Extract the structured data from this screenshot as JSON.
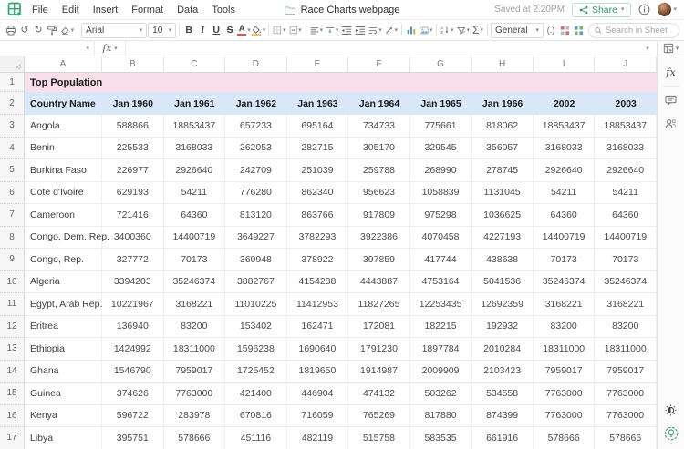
{
  "app": {
    "menus": [
      "File",
      "Edit",
      "Insert",
      "Format",
      "Data",
      "Tools"
    ],
    "doc_title": "Race Charts webpage",
    "saved_status": "Saved at 2.20PM",
    "share_label": "Share"
  },
  "toolbar": {
    "font_name": "Arial",
    "font_size": "10",
    "number_format": "General",
    "search_placeholder": "Search in Sheet",
    "format_buttons": {
      "bold": "B",
      "italic": "I",
      "underline": "U",
      "strikethrough": "S"
    },
    "glyphs": {
      "undo": "↺",
      "redo": "↻",
      "sum": "Σ",
      "decimal": "(.)",
      "font_color_letter": "A"
    }
  },
  "formula_bar": {
    "name_box_value": "",
    "fx_label": "fx",
    "formula_value": ""
  },
  "colors": {
    "title_row_bg": "#f8dfe9",
    "header_row_bg": "#d9e8f8",
    "accent_green": "#28a96c"
  },
  "grid": {
    "column_letters": [
      "A",
      "B",
      "C",
      "D",
      "E",
      "F",
      "G",
      "H",
      "I",
      "J"
    ],
    "title_row": {
      "n": "1",
      "text": "Top Population"
    },
    "header_row": {
      "n": "2",
      "cells": [
        "Country Name",
        "Jan 1960",
        "Jan 1961",
        "Jan 1962",
        "Jan 1963",
        "Jan 1964",
        "Jan 1965",
        "Jan 1966",
        "2002",
        "2003"
      ]
    },
    "rows": [
      {
        "n": "3",
        "country": "Angola",
        "values": [
          "588866",
          "18853437",
          "657233",
          "695164",
          "734733",
          "775661",
          "818062",
          "18853437",
          "18853437"
        ]
      },
      {
        "n": "4",
        "country": "Benin",
        "values": [
          "225533",
          "3168033",
          "262053",
          "282715",
          "305170",
          "329545",
          "356057",
          "3168033",
          "3168033"
        ]
      },
      {
        "n": "5",
        "country": "Burkina Faso",
        "values": [
          "226977",
          "2926640",
          "242709",
          "251039",
          "259788",
          "268990",
          "278745",
          "2926640",
          "2926640"
        ]
      },
      {
        "n": "6",
        "country": "Cote d'Ivoire",
        "values": [
          "629193",
          "54211",
          "776280",
          "862340",
          "956623",
          "1058839",
          "1131045",
          "54211",
          "54211"
        ]
      },
      {
        "n": "7",
        "country": "Cameroon",
        "values": [
          "721416",
          "64360",
          "813120",
          "863766",
          "917809",
          "975298",
          "1036625",
          "64360",
          "64360"
        ]
      },
      {
        "n": "8",
        "country": "Congo, Dem. Rep.",
        "values": [
          "3400360",
          "14400719",
          "3649227",
          "3782293",
          "3922386",
          "4070458",
          "4227193",
          "14400719",
          "14400719"
        ]
      },
      {
        "n": "9",
        "country": "Congo, Rep.",
        "values": [
          "327772",
          "70173",
          "360948",
          "378922",
          "397859",
          "417744",
          "438638",
          "70173",
          "70173"
        ]
      },
      {
        "n": "10",
        "country": "Algeria",
        "values": [
          "3394203",
          "35246374",
          "3882767",
          "4154288",
          "4443887",
          "4753164",
          "5041536",
          "35246374",
          "35246374"
        ]
      },
      {
        "n": "11",
        "country": "Egypt, Arab Rep.",
        "values": [
          "10221967",
          "3168221",
          "11010225",
          "11412953",
          "11827265",
          "12253435",
          "12692359",
          "3168221",
          "3168221"
        ]
      },
      {
        "n": "12",
        "country": "Eritrea",
        "values": [
          "136940",
          "83200",
          "153402",
          "162471",
          "172081",
          "182215",
          "192932",
          "83200",
          "83200"
        ]
      },
      {
        "n": "13",
        "country": "Ethiopia",
        "values": [
          "1424992",
          "18311000",
          "1596238",
          "1690640",
          "1791230",
          "1897784",
          "2010284",
          "18311000",
          "18311000"
        ]
      },
      {
        "n": "14",
        "country": "Ghana",
        "values": [
          "1546790",
          "7959017",
          "1725452",
          "1819650",
          "1914987",
          "2009909",
          "2103423",
          "7959017",
          "7959017"
        ]
      },
      {
        "n": "15",
        "country": "Guinea",
        "values": [
          "374626",
          "7763000",
          "421400",
          "446904",
          "474132",
          "503262",
          "534558",
          "7763000",
          "7763000"
        ]
      },
      {
        "n": "16",
        "country": "Kenya",
        "values": [
          "596722",
          "283978",
          "670816",
          "716059",
          "765269",
          "817880",
          "874399",
          "7763000",
          "7763000"
        ]
      },
      {
        "n": "17",
        "country": "Libya",
        "values": [
          "395751",
          "578666",
          "451116",
          "482119",
          "515758",
          "583535",
          "661916",
          "578666",
          "578666"
        ]
      }
    ]
  }
}
